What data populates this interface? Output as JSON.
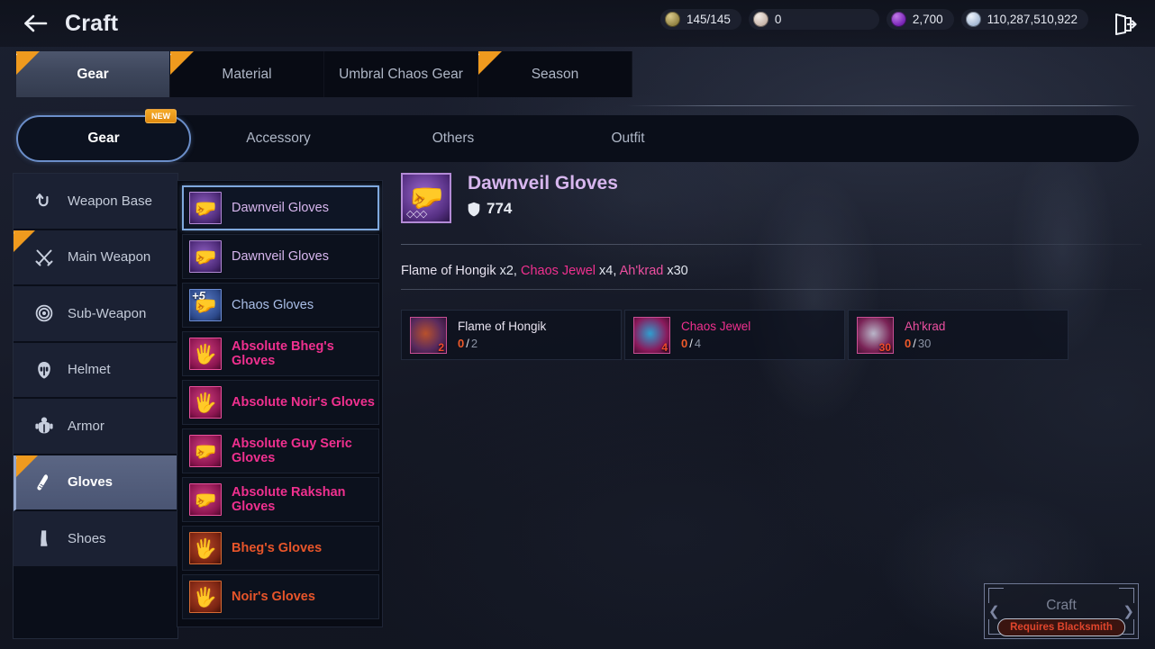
{
  "header": {
    "title": "Craft",
    "back_icon": "arrow-left-icon",
    "exit_icon": "exit-door-icon",
    "currencies": [
      {
        "id": "energy",
        "icon": "energy-coin-icon",
        "value": "145/145"
      },
      {
        "id": "pearl",
        "icon": "pearl-icon",
        "value": "0"
      },
      {
        "id": "gem",
        "icon": "purple-gem-icon",
        "value": "2,700"
      },
      {
        "id": "silver",
        "icon": "silver-coin-icon",
        "value": "110,287,510,922"
      }
    ]
  },
  "main_tabs": [
    {
      "label": "Gear",
      "active": true,
      "new": true
    },
    {
      "label": "Material",
      "active": false,
      "new": true
    },
    {
      "label": "Umbral Chaos Gear",
      "active": false,
      "new": false
    },
    {
      "label": "Season",
      "active": false,
      "new": true
    }
  ],
  "sub_tabs": [
    {
      "label": "Gear",
      "active": true,
      "new_badge": "NEW"
    },
    {
      "label": "Accessory",
      "active": false,
      "new_badge": null
    },
    {
      "label": "Others",
      "active": false,
      "new_badge": null
    },
    {
      "label": "Outfit",
      "active": false,
      "new_badge": null
    }
  ],
  "categories": [
    {
      "label": "Weapon Base",
      "icon": "undo-arrow-icon",
      "active": false,
      "new": false
    },
    {
      "label": "Main Weapon",
      "icon": "crossed-swords-icon",
      "active": false,
      "new": true
    },
    {
      "label": "Sub-Weapon",
      "icon": "target-ring-icon",
      "active": false,
      "new": false
    },
    {
      "label": "Helmet",
      "icon": "helmet-icon",
      "active": false,
      "new": false
    },
    {
      "label": "Armor",
      "icon": "armor-icon",
      "active": false,
      "new": false
    },
    {
      "label": "Gloves",
      "icon": "glove-icon",
      "active": true,
      "new": true
    },
    {
      "label": "Shoes",
      "icon": "boot-icon",
      "active": false,
      "new": false
    }
  ],
  "item_list": [
    {
      "name": "Dawnveil Gloves",
      "grade": "lavender",
      "thumb": "gauntlet-purple-icon",
      "selected": true,
      "enhance": null
    },
    {
      "name": "Dawnveil Gloves",
      "grade": "lavender",
      "thumb": "gauntlet-purple-icon",
      "selected": false,
      "enhance": null
    },
    {
      "name": "Chaos Gloves",
      "grade": "blue",
      "thumb": "gauntlet-blue-icon",
      "selected": false,
      "enhance": "+5"
    },
    {
      "name": "Absolute Bheg's Gloves",
      "grade": "magenta",
      "thumb": "gauntlet-magenta-icon",
      "selected": false,
      "enhance": null
    },
    {
      "name": "Absolute Noir's Gloves",
      "grade": "magenta",
      "thumb": "gauntlet-magenta-icon",
      "selected": false,
      "enhance": null
    },
    {
      "name": "Absolute Guy Seric Gloves",
      "grade": "magenta",
      "thumb": "gauntlet-magenta-icon",
      "selected": false,
      "enhance": null
    },
    {
      "name": "Absolute Rakshan Gloves",
      "grade": "magenta",
      "thumb": "gauntlet-magenta-icon",
      "selected": false,
      "enhance": null
    },
    {
      "name": "Bheg's Gloves",
      "grade": "orange",
      "thumb": "gauntlet-orange-icon",
      "selected": false,
      "enhance": null
    },
    {
      "name": "Noir's Gloves",
      "grade": "orange",
      "thumb": "gauntlet-orange-icon",
      "selected": false,
      "enhance": null
    }
  ],
  "detail": {
    "item_name": "Dawnveil Gloves",
    "defense_icon": "shield-icon",
    "defense_value": "774",
    "requirement_line": {
      "part1_name": "Flame of Hongik",
      "part1_qty": " x2, ",
      "part2_name": "Chaos Jewel",
      "part2_qty": " x4, ",
      "part3_name": "Ah'krad",
      "part3_qty": " x30"
    },
    "materials": [
      {
        "name": "Flame of Hongik",
        "thumb": "flame-of-hongik-icon",
        "badge_qty": "2",
        "have": "0",
        "sep": "/",
        "need": "2",
        "name_color": "#e7e2ef"
      },
      {
        "name": "Chaos Jewel",
        "thumb": "chaos-jewel-icon",
        "badge_qty": "4",
        "have": "0",
        "sep": "/",
        "need": "4",
        "name_color": "#f0308f"
      },
      {
        "name": "Ah'krad",
        "thumb": "ahkrad-icon",
        "badge_qty": "30",
        "have": "0",
        "sep": "/",
        "need": "30",
        "name_color": "#ec4fa0"
      }
    ]
  },
  "craft": {
    "label": "Craft",
    "disabled": true,
    "badge": "Requires Blacksmith"
  },
  "colors": {
    "accent_blue": "#6b8ec9",
    "new_orange": "#ef9a1e",
    "lavender": "#d7b6ee",
    "magenta": "#f0308f",
    "orange": "#e8552a",
    "blue_item": "#aabfe8",
    "shortage_red": "#ef5a2a",
    "bg_dark": "#11141f"
  }
}
